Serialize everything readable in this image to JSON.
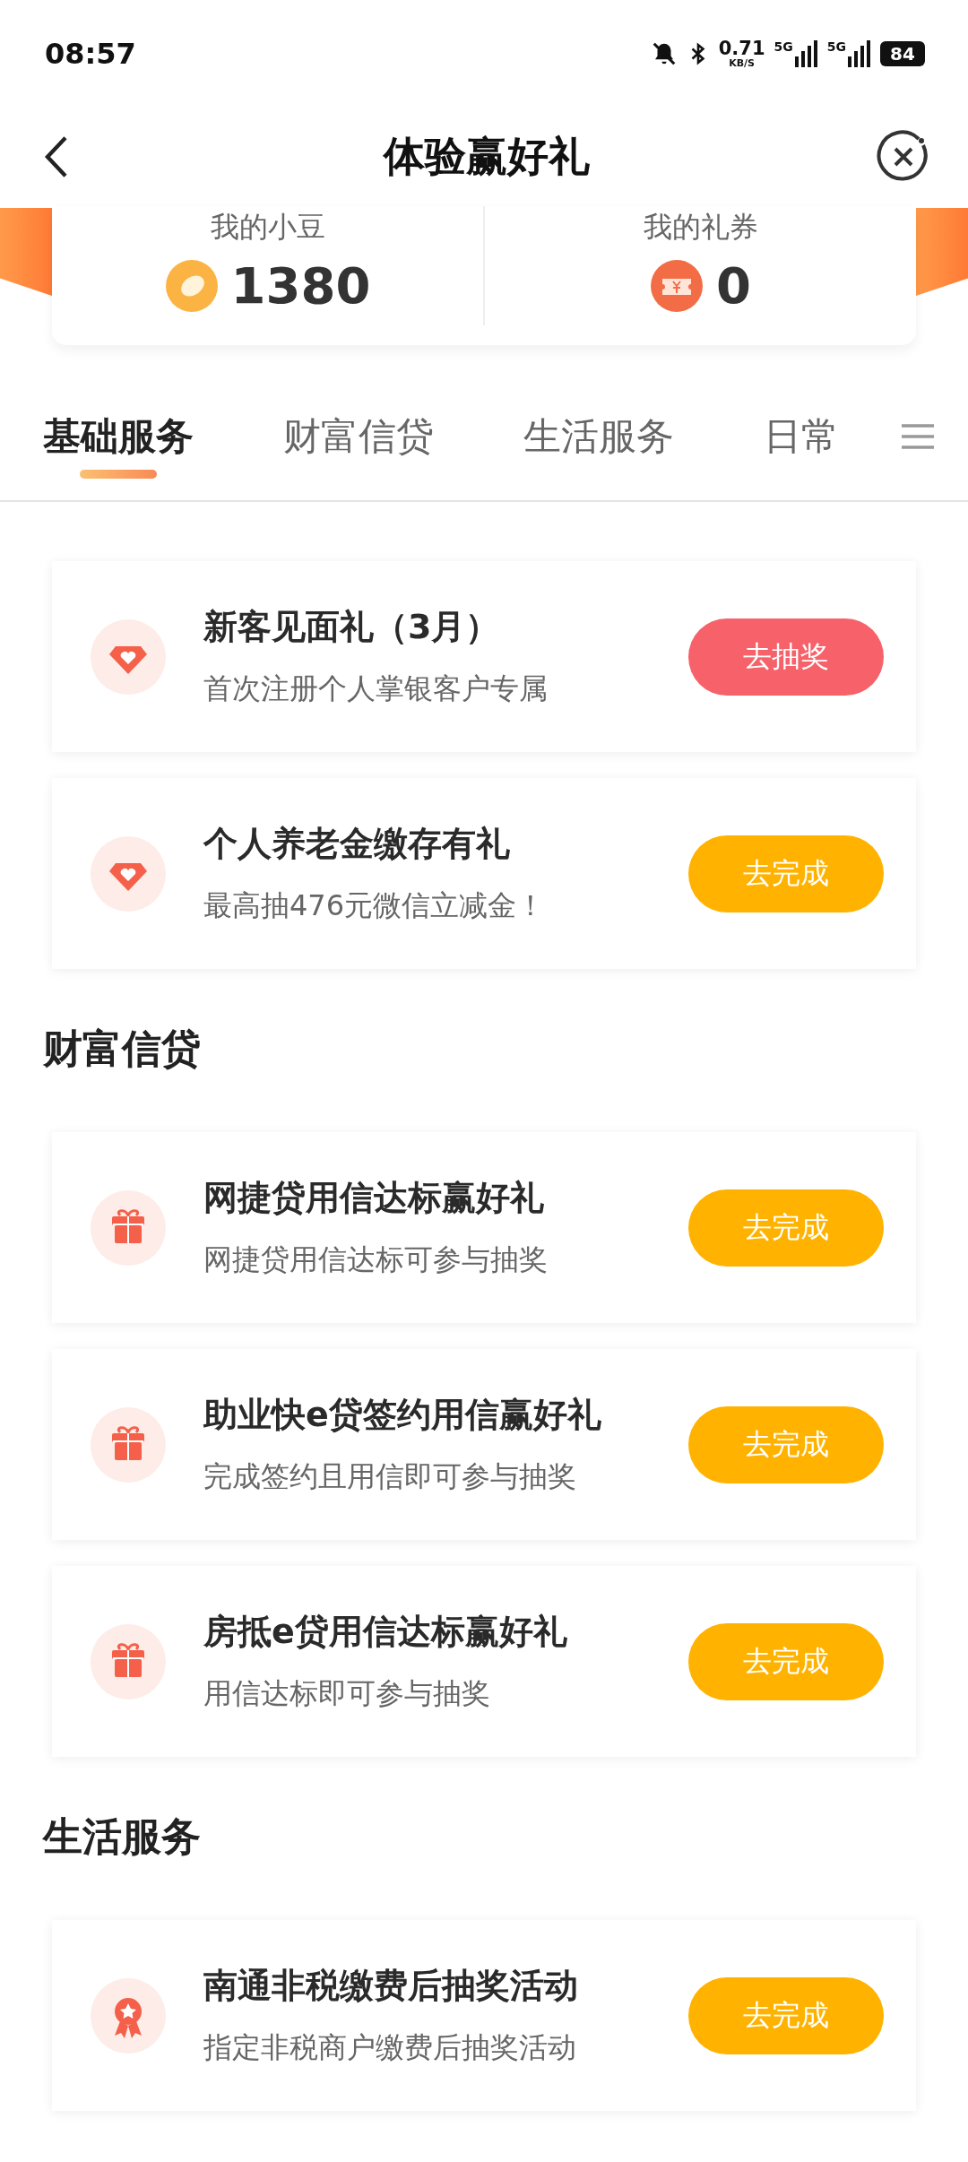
{
  "status_bar": {
    "time": "08:57",
    "network_speed": "0.71",
    "speed_unit": "KB/S",
    "sim_labels": [
      "5G",
      "5G"
    ],
    "battery": "84"
  },
  "header": {
    "title": "体验赢好礼"
  },
  "summary": [
    {
      "label": "我的小豆",
      "value": "1380",
      "kind": "bean"
    },
    {
      "label": "我的礼券",
      "value": "0",
      "kind": "coupon"
    }
  ],
  "tabs": [
    {
      "label": "基础服务",
      "selected": true
    },
    {
      "label": "财富信贷",
      "selected": false
    },
    {
      "label": "生活服务",
      "selected": false
    },
    {
      "label": "日常",
      "selected": false
    }
  ],
  "sections": [
    {
      "tasks": [
        {
          "title": "新客见面礼（3月）",
          "subtitle": "首次注册个人掌银客户专属",
          "kind": "diamond",
          "button": {
            "label": "去抽奖",
            "kind": "lottery"
          }
        },
        {
          "title": "个人养老金缴存有礼",
          "subtitle": "最高抽476元微信立减金！",
          "kind": "diamond",
          "button": {
            "label": "去完成",
            "kind": "complete"
          }
        }
      ]
    },
    {
      "heading": "财富信贷",
      "tasks": [
        {
          "title": "网捷贷用信达标赢好礼",
          "subtitle": "网捷贷用信达标可参与抽奖",
          "kind": "gift",
          "button": {
            "label": "去完成",
            "kind": "complete"
          }
        },
        {
          "title": "助业快e贷签约用信赢好礼",
          "subtitle": "完成签约且用信即可参与抽奖",
          "kind": "gift",
          "button": {
            "label": "去完成",
            "kind": "complete"
          }
        },
        {
          "title": "房抵e贷用信达标赢好礼",
          "subtitle": "用信达标即可参与抽奖",
          "kind": "gift",
          "button": {
            "label": "去完成",
            "kind": "complete"
          }
        }
      ]
    },
    {
      "heading": "生活服务",
      "tasks": [
        {
          "title": "南通非税缴费后抽奖活动",
          "subtitle": "指定非税商户缴费后抽奖活动",
          "kind": "medal",
          "button": {
            "label": "去完成",
            "kind": "complete"
          }
        }
      ]
    }
  ]
}
